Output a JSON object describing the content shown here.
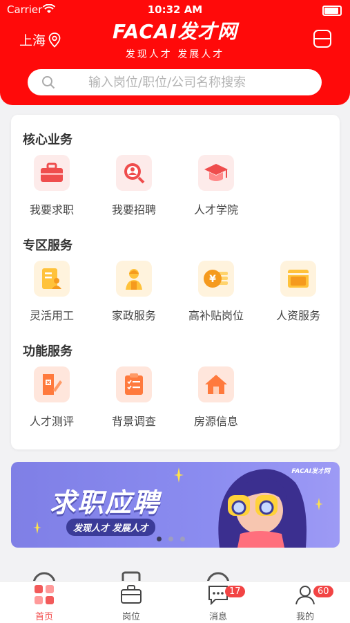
{
  "status": {
    "carrier": "Carrier",
    "time": "10:32 AM"
  },
  "header": {
    "city": "上海",
    "brand": "FACAI发才网",
    "slogan": "发现人才  发展人才"
  },
  "search": {
    "placeholder": "输入岗位/职位/公司名称搜索"
  },
  "sections": [
    {
      "title": "核心业务",
      "items": [
        {
          "label": "我要求职",
          "icon": "briefcase-icon"
        },
        {
          "label": "我要招聘",
          "icon": "recruit-search-icon"
        },
        {
          "label": "人才学院",
          "icon": "graduation-cap-icon"
        }
      ]
    },
    {
      "title": "专区服务",
      "items": [
        {
          "label": "灵活用工",
          "icon": "worker-card-icon"
        },
        {
          "label": "家政服务",
          "icon": "housekeeper-icon"
        },
        {
          "label": "高补贴岗位",
          "icon": "yen-coin-icon"
        },
        {
          "label": "人资服务",
          "icon": "folder-icon"
        }
      ]
    },
    {
      "title": "功能服务",
      "items": [
        {
          "label": "人才测评",
          "icon": "assessment-pen-icon"
        },
        {
          "label": "背景调查",
          "icon": "checklist-icon"
        },
        {
          "label": "房源信息",
          "icon": "house-icon"
        }
      ]
    }
  ],
  "banner": {
    "headline": "求职应聘",
    "tagline": "发现人才 发展人才",
    "logo": "FACAI发才网"
  },
  "tabs": [
    {
      "label": "首页",
      "icon": "home-grid-icon",
      "badge": ""
    },
    {
      "label": "岗位",
      "icon": "briefcase-icon",
      "badge": ""
    },
    {
      "label": "消息",
      "icon": "message-icon",
      "badge": "17"
    },
    {
      "label": "我的",
      "icon": "user-icon",
      "badge": "60"
    }
  ],
  "colors": {
    "brand": "#ff0a0a",
    "accent": "#f24a4a",
    "orange": "#ff7a3d",
    "yellow": "#ffc23a",
    "banner": "#8585ec"
  }
}
